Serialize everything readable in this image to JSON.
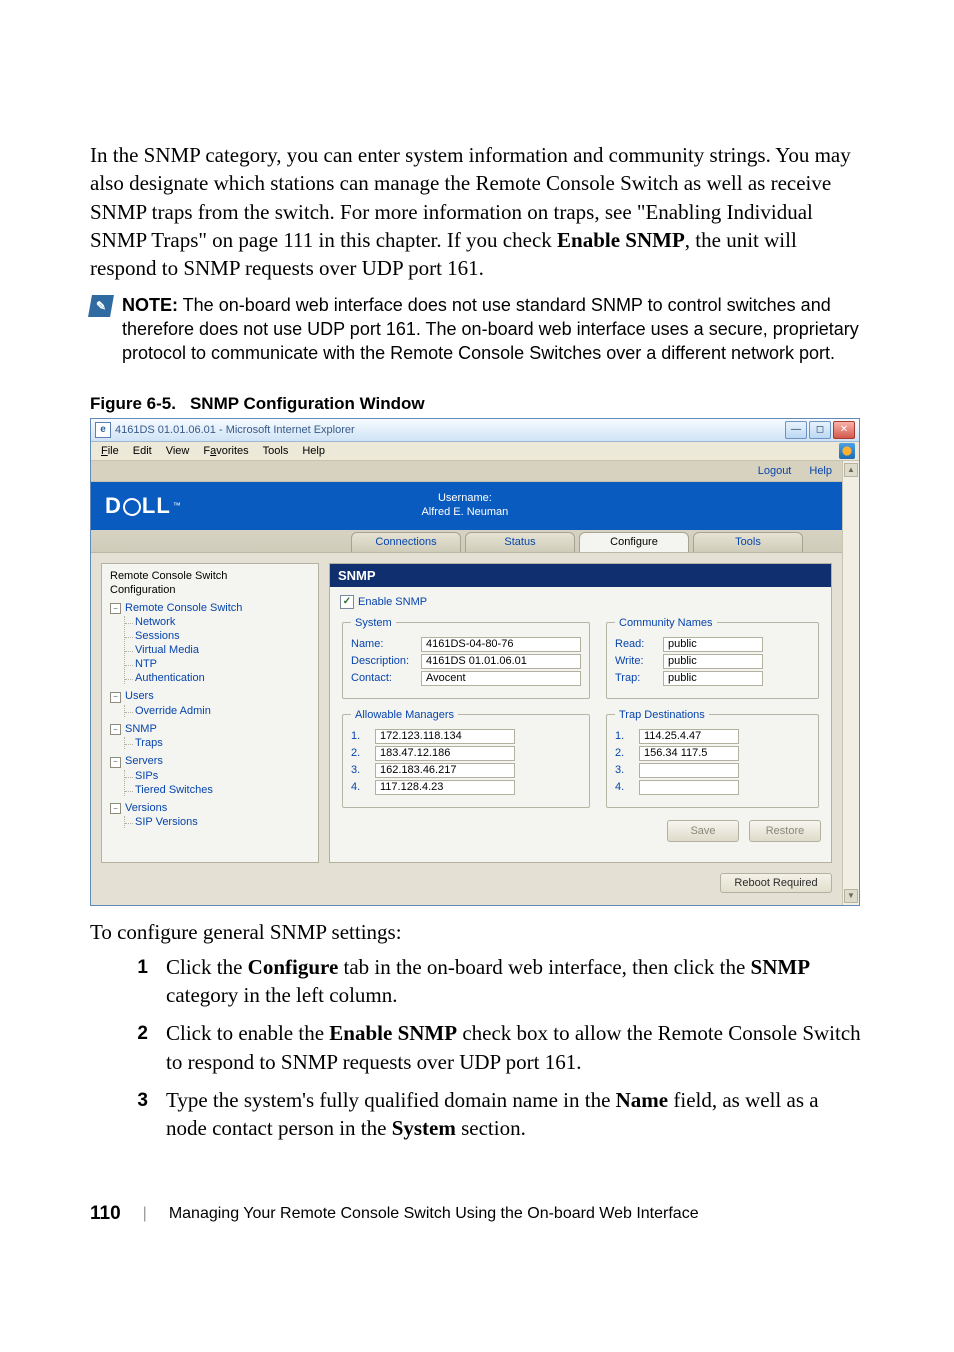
{
  "intro": "In the SNMP category, you can enter system information and community strings. You may also designate which stations can manage the Remote Console Switch as well as receive SNMP traps from the switch. For more information on traps, see \"Enabling Individual SNMP Traps\" on page 111 in this chapter. If you check ",
  "intro_bold": "Enable SNMP",
  "intro_tail": ", the unit will respond to SNMP requests over UDP port 161.",
  "note_label": "NOTE:",
  "note_text": " The on-board web interface does not use standard SNMP to control switches and therefore does not use UDP port 161. The on-board web interface uses a secure, proprietary protocol to communicate with the Remote Console Switches over a different network port.",
  "figure_no": "Figure 6-5.",
  "figure_title": "SNMP Configuration Window",
  "window": {
    "title": "4161DS 01.01.06.01 - Microsoft Internet Explorer",
    "menus": {
      "file": "File",
      "edit": "Edit",
      "view": "View",
      "favorites": "Favorites",
      "tools": "Tools",
      "help": "Help"
    },
    "toplinks": {
      "logout": "Logout",
      "help": "Help"
    },
    "banner": {
      "user_label": "Username:",
      "user": "Alfred E. Neuman"
    },
    "tabs": {
      "connections": "Connections",
      "status": "Status",
      "configure": "Configure",
      "tools": "Tools"
    },
    "tree": {
      "title1": "Remote Console Switch",
      "title2": "Configuration",
      "root": "Remote Console Switch",
      "network": "Network",
      "sessions": "Sessions",
      "virtual_media": "Virtual Media",
      "ntp": "NTP",
      "authentication": "Authentication",
      "users": "Users",
      "override_admin": "Override Admin",
      "snmp": "SNMP",
      "traps": "Traps",
      "servers": "Servers",
      "sips": "SIPs",
      "tiered": "Tiered Switches",
      "versions": "Versions",
      "sip_versions": "SIP Versions"
    },
    "form": {
      "header": "SNMP",
      "enable": "Enable SNMP",
      "system": {
        "legend": "System",
        "name_label": "Name:",
        "name": "4161DS-04-80-76",
        "desc_label": "Description:",
        "desc": "4161DS 01.01.06.01",
        "contact_label": "Contact:",
        "contact": "Avocent"
      },
      "managers": {
        "legend": "Allowable Managers",
        "m1": "172.123.118.134",
        "m2": "183.47.12.186",
        "m3": "162.183.46.217",
        "m4": "117.128.4.23"
      },
      "community": {
        "legend": "Community Names",
        "read_label": "Read:",
        "read": "public",
        "write_label": "Write:",
        "write": "public",
        "trap_label": "Trap:",
        "trap": "public"
      },
      "trapdest": {
        "legend": "Trap Destinations",
        "t1": "114.25.4.47",
        "t2": "156.34 117.5",
        "t3": "",
        "t4": ""
      },
      "save": "Save",
      "restore": "Restore",
      "reboot": "Reboot Required"
    }
  },
  "steps_intro": "To configure general SNMP settings:",
  "steps": {
    "s1a": "Click the ",
    "s1b": "Configure",
    "s1c": " tab in the on-board web interface, then click the ",
    "s1d": "SNMP",
    "s1e": " category in the left column.",
    "s2a": "Click to enable the ",
    "s2b": "Enable SNMP",
    "s2c": " check box to allow the Remote Console Switch to respond to SNMP requests over UDP port 161.",
    "s3a": "Type the system's fully qualified domain name in the ",
    "s3b": "Name",
    "s3c": " field, as well as a node contact person in the ",
    "s3d": "System",
    "s3e": " section."
  },
  "footer": {
    "page": "110",
    "chapter": "Managing Your Remote Console Switch Using the On-board Web Interface"
  }
}
